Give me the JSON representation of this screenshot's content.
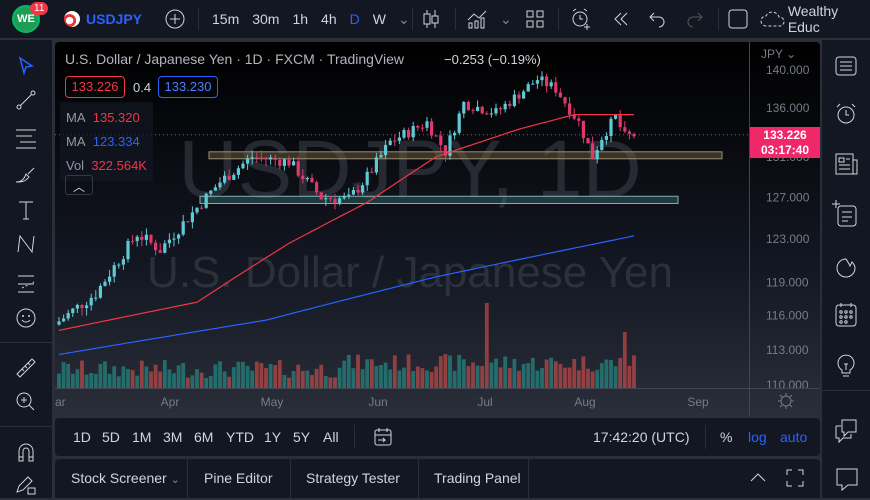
{
  "topbar": {
    "notification_count": "11",
    "symbol": "USDJPY",
    "intervals": [
      "15m",
      "30m",
      "1h",
      "4h",
      "D",
      "W"
    ],
    "active_interval": "D",
    "account_name": "Wealthy Educ"
  },
  "legend": {
    "title": "U.S. Dollar / Japanese Yen · 1D · FXCM · TradingView",
    "change": "−0.253 (−0.19%)",
    "sell_price": "133.226",
    "spread": "0.4",
    "buy_price": "133.230",
    "ma1_label": "MA",
    "ma1_value": "135.320",
    "ma2_label": "MA",
    "ma2_value": "123.334",
    "vol_label": "Vol",
    "vol_value": "322.564K"
  },
  "watermark": {
    "line1": "USDJPY, 1D",
    "line2": "U.S. Dollar / Japanese Yen"
  },
  "axis": {
    "currency": "JPY",
    "current_price": "133.226",
    "countdown": "03:17:40"
  },
  "bottom": {
    "ranges": [
      "1D",
      "5D",
      "1M",
      "3M",
      "6M",
      "YTD",
      "1Y",
      "5Y",
      "All"
    ],
    "clock": "17:42:20 (UTC)",
    "percent": "%",
    "log": "log",
    "auto": "auto"
  },
  "panel_tabs": [
    "Stock Screener",
    "Pine Editor",
    "Strategy Tester",
    "Trading Panel"
  ],
  "colors": {
    "up": "#26a69a",
    "down": "#ef5350",
    "ma1": "#f23645",
    "ma2": "#2962ff",
    "accent": "#2962ff",
    "price_label": "#f0286a"
  },
  "chart_data": {
    "type": "candlestick",
    "scale": "log",
    "yticks": [
      140,
      136,
      131,
      127,
      123,
      119,
      116,
      113,
      110
    ],
    "ytick_labels": [
      "140.000",
      "136.000",
      "131.000",
      "127.000",
      "123.000",
      "119.000",
      "116.000",
      "113.000",
      "110.000"
    ],
    "xticks": [
      "Mar",
      "Apr",
      "May",
      "Jun",
      "Jul",
      "Aug",
      "Sep"
    ],
    "ylim": [
      110,
      140
    ],
    "close_keypoints": [
      [
        0,
        115.5
      ],
      [
        8,
        118
      ],
      [
        17,
        123.5
      ],
      [
        22,
        122
      ],
      [
        35,
        128.5
      ],
      [
        42,
        131
      ],
      [
        50,
        130.5
      ],
      [
        57,
        127
      ],
      [
        63,
        126.8
      ],
      [
        67,
        129
      ],
      [
        72,
        132.5
      ],
      [
        80,
        134.5
      ],
      [
        84,
        131.5
      ],
      [
        88,
        136.5
      ],
      [
        95,
        135.5
      ],
      [
        104,
        139
      ],
      [
        108,
        138
      ],
      [
        113,
        134.5
      ],
      [
        116,
        131
      ],
      [
        118,
        133
      ],
      [
        121,
        135
      ],
      [
        123,
        133
      ],
      [
        125,
        133.2
      ]
    ],
    "ma50_keypoints": [
      [
        0,
        114.7
      ],
      [
        30,
        117.2
      ],
      [
        50,
        122.6
      ],
      [
        67,
        126.5
      ],
      [
        82,
        131
      ],
      [
        100,
        133.8
      ],
      [
        112,
        135.3
      ],
      [
        125,
        135.3
      ]
    ],
    "ma200_keypoints": [
      [
        0,
        112.6
      ],
      [
        45,
        115.6
      ],
      [
        82,
        119.5
      ],
      [
        125,
        123.3
      ]
    ],
    "zones": [
      {
        "from": 130.8,
        "to": 131.5,
        "type": "resistance"
      },
      {
        "from": 126.4,
        "to": 127.1,
        "type": "support"
      }
    ]
  }
}
